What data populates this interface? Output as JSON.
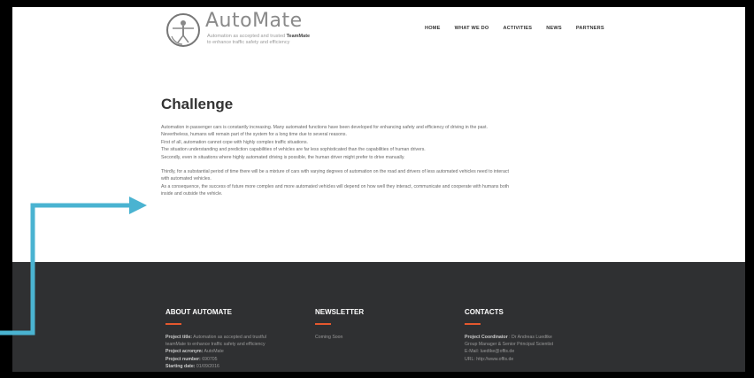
{
  "brand": {
    "name": "AutoMate",
    "tagline_pre": "Automation as accepted and trusted ",
    "tagline_strong": "TeamMate",
    "tagline_post": "to enhance traffic safety and efficiency"
  },
  "nav": [
    "HOME",
    "WHAT WE DO",
    "ACTIVITIES",
    "NEWS",
    "PARTNERS"
  ],
  "main": {
    "title": "Challenge",
    "paragraph1": [
      "Automation in passenger cars is constantly increasing. Many automated functions have been developed for enhancing safety and efficiency of driving in the past.",
      "Nevertheless, humans will remain part of the system for a long time due to several reasons.",
      "First of all, automation cannot cope with highly complex traffic situations.",
      "The situation understanding and prediction capabilities of vehicles are far less sophisticated than the capabilities of human drivers.",
      "Secondly, even in situations where highly automated driving is possible, the human driver might prefer to drive manually."
    ],
    "paragraph2": [
      "Thirdly, for a substantial period of time there will be a mixture of cars with varying degrees of automation on the road and drivers of less automated vehicles need to interact",
      "with automated vehicles.",
      "As a consequence, the success of future more complex and more automated vehicles will depend on how well they interact, communicate and cooperate with humans both",
      "inside and outside the vehicle."
    ]
  },
  "footer": {
    "about": {
      "heading": "ABOUT AUTOMATE",
      "title_label": "Project title:",
      "title_value": " Automation as accepted and trustful",
      "title_value2": "teamMate to enhance traffic safety and efficiency",
      "acronym_label": "Project acronym:",
      "acronym_value": " AutoMate",
      "number_label": "Project number:",
      "number_value": " 690705",
      "start_label": "Starting date:",
      "start_value": " 01/09/2016"
    },
    "newsletter": {
      "heading": "NEWSLETTER",
      "text": "Coming Soon"
    },
    "contacts": {
      "heading": "CONTACTS",
      "coord_label": "Project Coordinator",
      "coord_value": " : Dr Andreas Luedtke",
      "role": "Group Manager & Senior Principal Scientist",
      "email": "E-Mail: luedtke@offis.de",
      "url": "URL: http://www.offis.de"
    }
  },
  "colors": {
    "arrow": "#4ab3d1",
    "footer_bg": "#2f3032",
    "accent": "#e4572e"
  }
}
